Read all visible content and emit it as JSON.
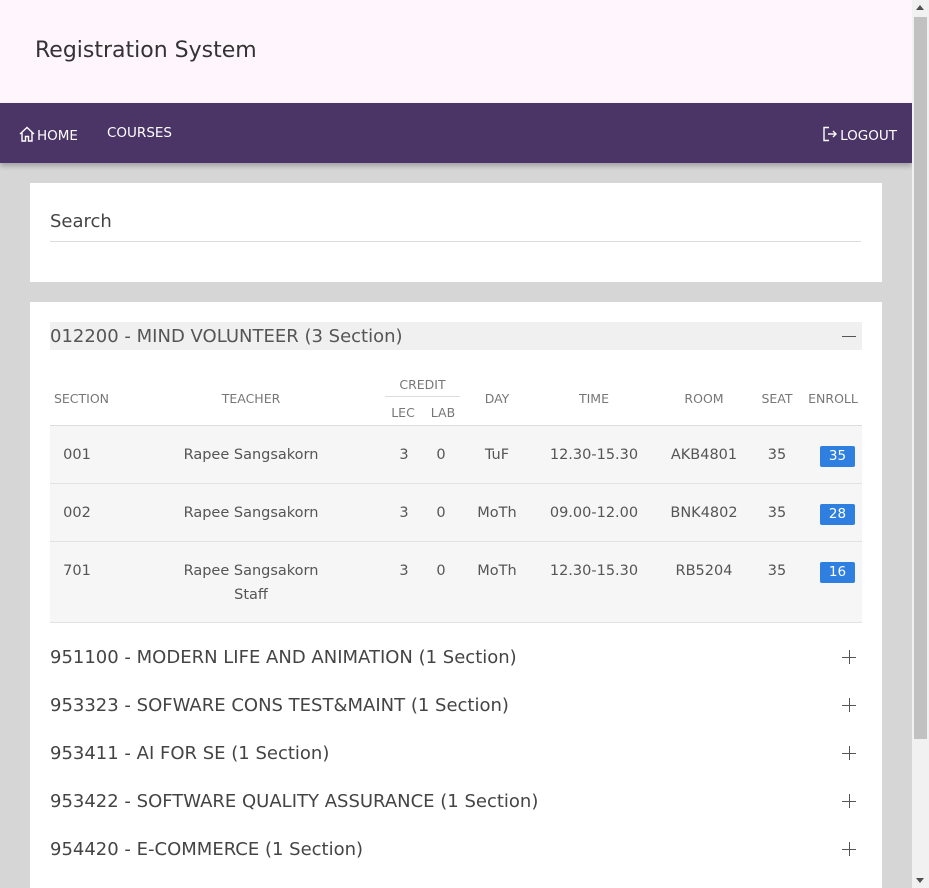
{
  "header": {
    "title": "Registration System"
  },
  "nav": {
    "home": "HOME",
    "courses": "COURSES",
    "logout": "LOGOUT",
    "home_icon": "home-icon",
    "logout_icon": "logout-icon"
  },
  "search": {
    "placeholder": "Search",
    "value": ""
  },
  "table_headers": {
    "section": "SECTION",
    "teacher": "TEACHER",
    "credit": "CREDIT",
    "lec": "LEC",
    "lab": "LAB",
    "day": "DAY",
    "time": "TIME",
    "room": "ROOM",
    "seat": "SEAT",
    "enroll": "ENROLL"
  },
  "courses": [
    {
      "title": "012200 - MIND VOLUNTEER (3 Section)",
      "expanded": true,
      "sections": [
        {
          "section": "001",
          "teacher": "Rapee Sangsakorn",
          "teacher2": "",
          "lec": "3",
          "lab": "0",
          "day": "TuF",
          "time": "12.30-15.30",
          "room": "AKB4801",
          "seat": "35",
          "enroll": "35"
        },
        {
          "section": "002",
          "teacher": "Rapee Sangsakorn",
          "teacher2": "",
          "lec": "3",
          "lab": "0",
          "day": "MoTh",
          "time": "09.00-12.00",
          "room": "BNK4802",
          "seat": "35",
          "enroll": "28"
        },
        {
          "section": "701",
          "teacher": "Rapee Sangsakorn",
          "teacher2": "Staff",
          "lec": "3",
          "lab": "0",
          "day": "MoTh",
          "time": "12.30-15.30",
          "room": "RB5204",
          "seat": "35",
          "enroll": "16"
        }
      ]
    },
    {
      "title": "951100 - MODERN LIFE AND ANIMATION (1 Section)",
      "expanded": false
    },
    {
      "title": "953323 - SOFWARE CONS TEST&MAINT (1 Section)",
      "expanded": false
    },
    {
      "title": "953411 - AI FOR SE (1 Section)",
      "expanded": false
    },
    {
      "title": "953422 - SOFTWARE QUALITY ASSURANCE (1 Section)",
      "expanded": false
    },
    {
      "title": "954420 - E-COMMERCE (1 Section)",
      "expanded": false
    }
  ],
  "colors": {
    "navbar": "#4a3566",
    "header_bg": "#fff5fd",
    "enroll_badge": "#2f7fe0"
  }
}
